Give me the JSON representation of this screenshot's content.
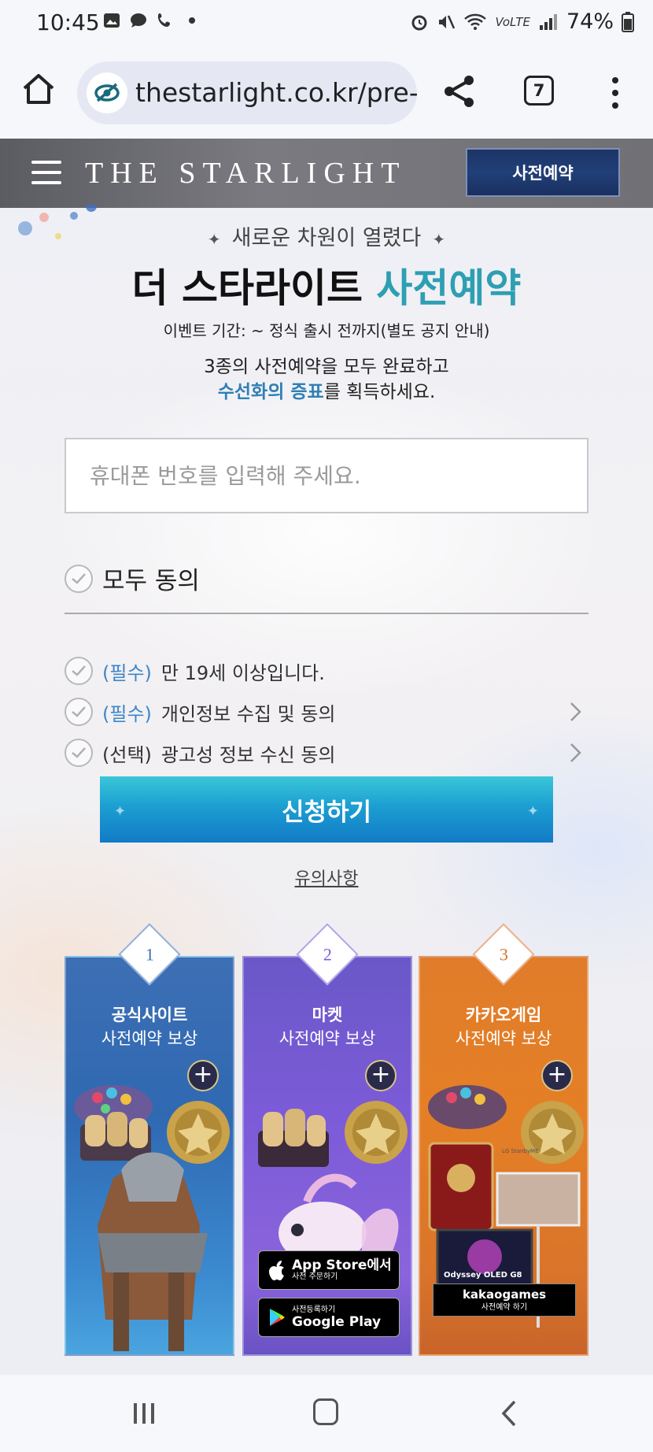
{
  "status_bar": {
    "time": "10:45",
    "battery": "74%",
    "volte": "VoLTE"
  },
  "browser": {
    "url": "thestarlight.co.kr/pre-re",
    "tab_count": "7"
  },
  "site": {
    "logo": "THE STARLIGHT",
    "pre_register_button": "사전예약"
  },
  "hero": {
    "subtitle": "새로운 차원이 열렸다",
    "title_main": "더 스타라이트",
    "title_accent": "사전예약",
    "event_period": "이벤트 기간: ~ 정식 출시 전까지(별도 공지 안내)",
    "desc_line1": "3종의 사전예약을 모두 완료하고",
    "desc_line2_highlight": "수선화의 증표",
    "desc_line2_rest": "를 획득하세요."
  },
  "form": {
    "phone_placeholder": "휴대폰 번호를 입력해 주세요.",
    "agree_all": "모두 동의",
    "agreements": [
      {
        "tag": "(필수)",
        "text": "만 19세 이상입니다."
      },
      {
        "tag": "(필수)",
        "text": "개인정보 수집 및 동의"
      },
      {
        "tag": "(선택)",
        "text": "광고성 정보 수신 동의"
      }
    ],
    "apply_button": "신청하기",
    "notice_link": "유의사항"
  },
  "rewards": [
    {
      "number": "1",
      "title": "공식사이트",
      "subtitle": "사전예약 보상"
    },
    {
      "number": "2",
      "title": "마켓",
      "subtitle": "사전예약 보상",
      "appstore_big": "App Store에서",
      "appstore_small": "사전 주문하기",
      "googleplay_small": "사전등록하기",
      "googleplay_big": "Google Play"
    },
    {
      "number": "3",
      "title": "카카오게임",
      "subtitle": "사전예약 보상",
      "kakao_big": "kakaogames",
      "kakao_small": "사전예약 하기",
      "monitor_text": "Odyssey OLED G8",
      "stand_text": "LG StanbyME"
    }
  ],
  "colors": {
    "accent_teal": "#2e9fb2",
    "highlight_blue": "#2f7fb5",
    "required_blue": "#3e86c8",
    "header_button_navy": "#1c3566"
  }
}
